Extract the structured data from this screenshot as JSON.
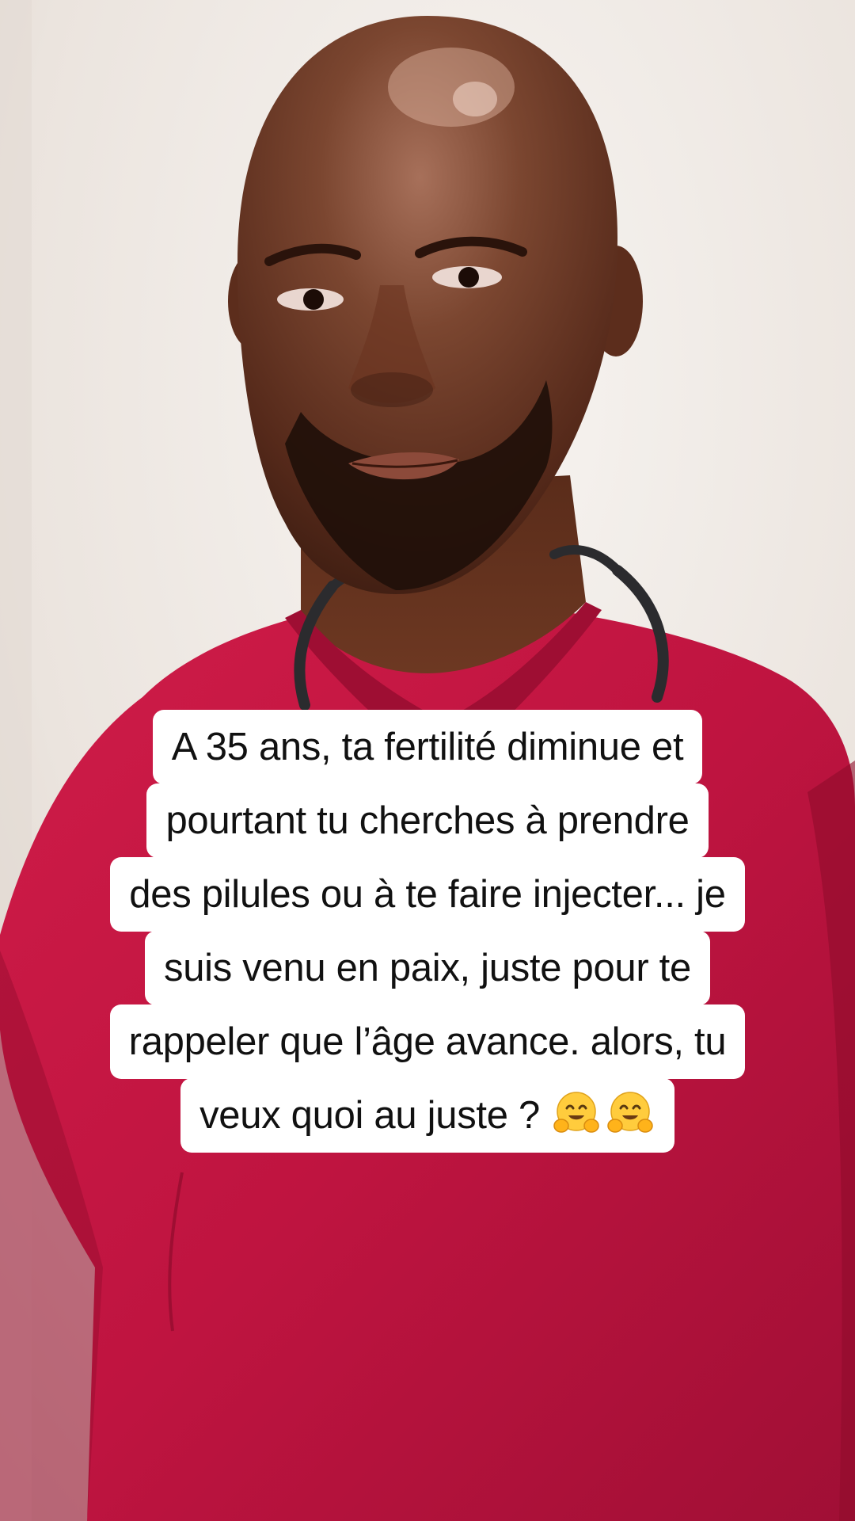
{
  "video": {
    "subject": "man-in-red-scrubs-with-stethoscope",
    "colors": {
      "background": "#efe9e4",
      "scrubs": "#c4163f",
      "skin": "#6e3a24",
      "caption_bg": "#ffffff",
      "caption_text": "#111111"
    }
  },
  "caption": {
    "lines": [
      "A 35 ans, ta fertilité diminue et",
      "pourtant tu cherches à prendre",
      "des pilules ou à te faire injecter... je",
      "suis venu en paix, juste pour te",
      "rappeler que l’âge avance. alors, tu",
      "veux quoi au juste ?"
    ],
    "emojis": [
      "hugging-face-icon",
      "hugging-face-icon"
    ]
  }
}
